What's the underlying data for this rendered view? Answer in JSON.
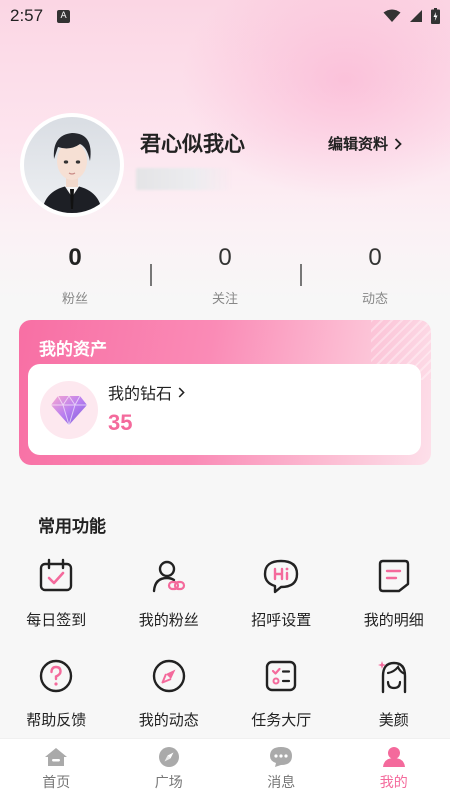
{
  "status_bar": {
    "time": "2:57",
    "notification_letter": "A"
  },
  "profile": {
    "nickname": "君心似我心",
    "edit_label": "编辑资料"
  },
  "stats": [
    {
      "value": "0",
      "label": "粉丝"
    },
    {
      "value": "0",
      "label": "关注"
    },
    {
      "value": "0",
      "label": "动态"
    }
  ],
  "assets": {
    "title": "我的资产",
    "diamond_label": "我的钻石",
    "diamond_value": "35"
  },
  "functions": {
    "title": "常用功能",
    "items": [
      {
        "label": "每日签到",
        "icon": "calendar-check-icon"
      },
      {
        "label": "我的粉丝",
        "icon": "fans-icon"
      },
      {
        "label": "招呼设置",
        "icon": "hi-bubble-icon"
      },
      {
        "label": "我的明细",
        "icon": "document-icon"
      },
      {
        "label": "帮助反馈",
        "icon": "help-icon"
      },
      {
        "label": "我的动态",
        "icon": "compass-icon"
      },
      {
        "label": "任务大厅",
        "icon": "task-list-icon"
      },
      {
        "label": "美颜",
        "icon": "beauty-face-icon"
      }
    ]
  },
  "tabs": [
    {
      "label": "首页",
      "icon": "home-icon",
      "active": false
    },
    {
      "label": "广场",
      "icon": "compass-icon",
      "active": false
    },
    {
      "label": "消息",
      "icon": "chat-icon",
      "active": false
    },
    {
      "label": "我的",
      "icon": "user-icon",
      "active": true
    }
  ],
  "colors": {
    "accent": "#f46a9c",
    "card_gradient_start": "#f86fa4"
  }
}
